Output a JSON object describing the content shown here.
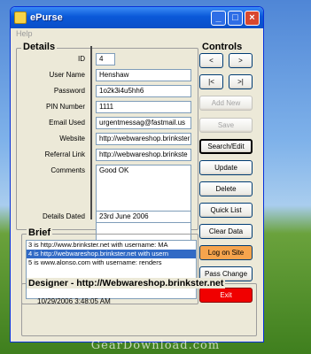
{
  "window": {
    "title": "ePurse",
    "menu": [
      "Help"
    ]
  },
  "details": {
    "heading": "Details",
    "fields": [
      {
        "label": "ID",
        "value": "4"
      },
      {
        "label": "User Name",
        "value": "Henshaw"
      },
      {
        "label": "Password",
        "value": "1o2k3i4u5hh6"
      },
      {
        "label": "PIN Number",
        "value": "1111"
      },
      {
        "label": "Email Used",
        "value": "urgentmessag@fastmail.us"
      },
      {
        "label": "Website",
        "value": "http://webwareshop.brinkster"
      },
      {
        "label": "Referral Link",
        "value": "http://webwareshop.brinkste"
      },
      {
        "label": "Comments",
        "value": "Good OK"
      },
      {
        "label": "Details Dated",
        "value": "23rd June 2006"
      }
    ]
  },
  "controls": {
    "heading": "Controls",
    "nav": {
      "prev": "<",
      "next": ">",
      "first": "|<",
      "last": ">|"
    },
    "buttons": {
      "add_new": "Add New",
      "save": "Save",
      "search_edit": "Search/Edit",
      "update": "Update",
      "delete": "Delete",
      "quick_list": "Quick List",
      "clear_data": "Clear Data",
      "log_on_site": "Log on Site",
      "pass_change": "Pass Change",
      "exit": "Exit"
    }
  },
  "brief": {
    "heading": "Brief",
    "items": [
      "3  is  http://www.brinkster.net with username: MA",
      "4  is  http://webwareshop.brinkster.net with usern",
      "5  is  www.alonso.com with username: renders"
    ],
    "selected_index": 1
  },
  "designer": {
    "heading": "Designer - http://Webwareshop.brinkster.net",
    "timestamp": "10/29/2006 3:48:05 AM"
  },
  "watermark": "GearDownload.com",
  "colors": {
    "titlebar": "#0a58d8",
    "exit_button": "#f00000",
    "log_on_button": "#f6a44d",
    "selection": "#316ac5"
  }
}
